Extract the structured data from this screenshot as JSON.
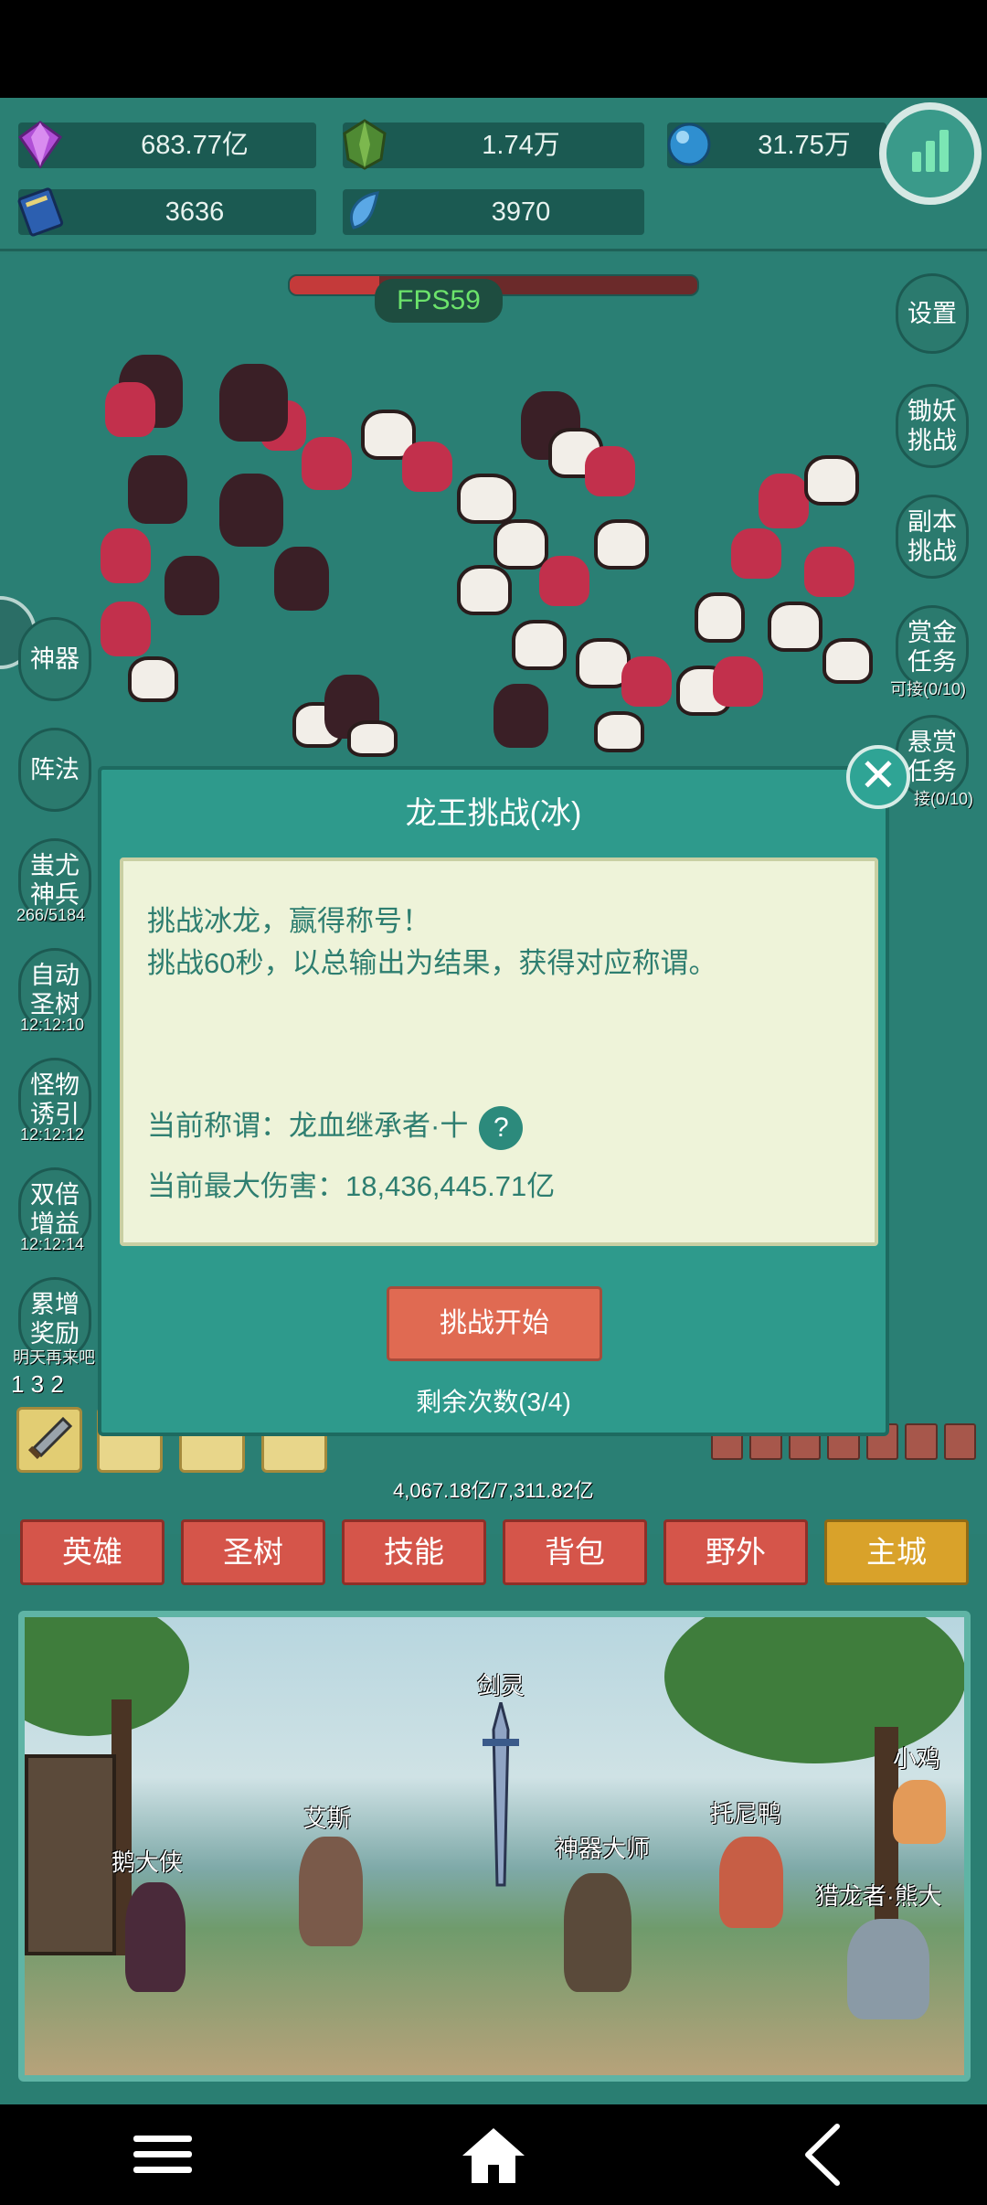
{
  "resources": [
    {
      "icon": "gem-icon",
      "value": "683.77亿"
    },
    {
      "icon": "green-crystal-icon",
      "value": "1.74万"
    },
    {
      "icon": "blue-orb-icon",
      "value": "31.75万"
    },
    {
      "icon": "book-icon",
      "value": "3636"
    },
    {
      "icon": "ice-shard-icon",
      "value": "3970"
    }
  ],
  "fps": "FPS59",
  "boss_hp_fraction": 0.22,
  "left_menu": [
    {
      "label": "神器",
      "sub": ""
    },
    {
      "label": "阵法",
      "sub": ""
    },
    {
      "label": "蚩尤神兵",
      "sub": "266/5184"
    },
    {
      "label": "自动圣树",
      "sub": "12:12:10"
    },
    {
      "label": "怪物诱引",
      "sub": "12:12:12"
    },
    {
      "label": "双倍增益",
      "sub": "12:12:14"
    },
    {
      "label": "累增奖励",
      "sub": "明天再来吧"
    }
  ],
  "right_menu": [
    {
      "label": "设置",
      "sub": ""
    },
    {
      "label": "锄妖挑战",
      "sub": ""
    },
    {
      "label": "副本挑战",
      "sub": ""
    },
    {
      "label": "赏金任务",
      "sub": "可接(0/10)"
    },
    {
      "label": "悬赏任务",
      "sub": "接(0/10)"
    }
  ],
  "modal": {
    "title": "龙王挑战(冰)",
    "close": "✕",
    "desc1": "挑战冰龙，赢得称号！",
    "desc2": "挑战60秒，以总输出为结果，获得对应称谓。",
    "current_title": "当前称谓：龙血继承者·十",
    "help": "?",
    "max_damage": "当前最大伤害：18,436,445.71亿",
    "start_button": "挑战开始",
    "remaining": "剩余次数(3/4)"
  },
  "equip_nums": "1 3 2",
  "exp_text": "4,067.18亿/7,311.82亿",
  "tabs": [
    {
      "label": "英雄",
      "active": false
    },
    {
      "label": "圣树",
      "active": false
    },
    {
      "label": "技能",
      "active": false
    },
    {
      "label": "背包",
      "active": false
    },
    {
      "label": "野外",
      "active": false
    },
    {
      "label": "主城",
      "active": true
    }
  ],
  "npcs": [
    "剑灵",
    "小鸡",
    "艾斯",
    "托尼鸭",
    "鹅大侠",
    "神器大师",
    "猎龙者·熊大"
  ]
}
